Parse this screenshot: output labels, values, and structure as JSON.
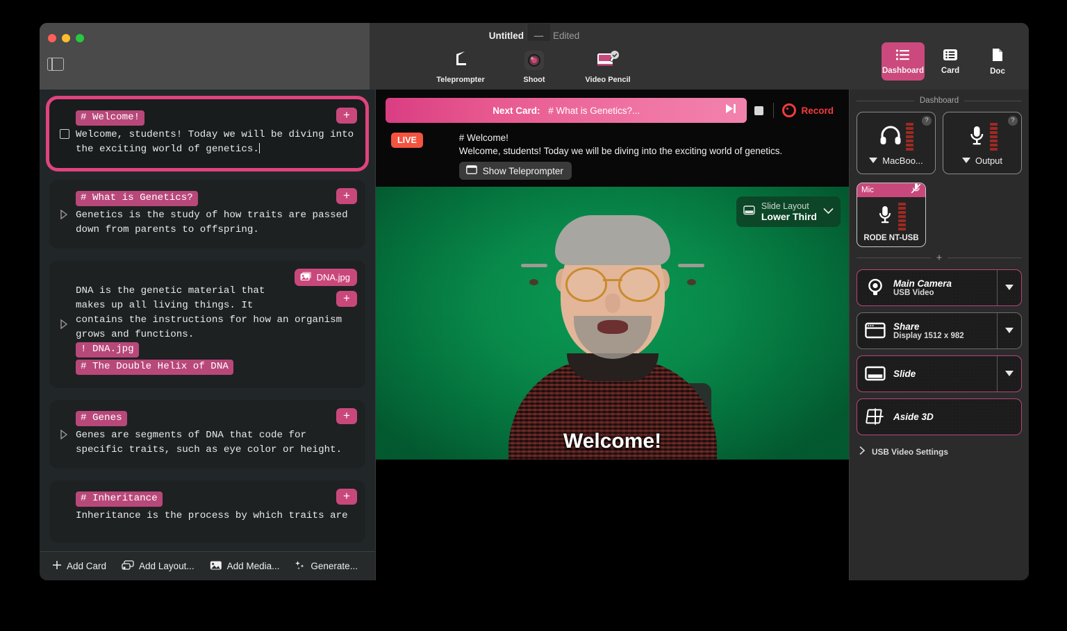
{
  "window": {
    "title": "Untitled",
    "dash": "—",
    "edited": "Edited"
  },
  "toolbar": {
    "items": [
      {
        "label": "Teleprompter",
        "icon": "teleprompter-icon"
      },
      {
        "label": "Shoot",
        "icon": "shoot-icon"
      },
      {
        "label": "Video Pencil",
        "icon": "video-pencil-icon"
      }
    ]
  },
  "view_switch": {
    "items": [
      {
        "label": "Dashboard",
        "icon": "list-icon",
        "active": true
      },
      {
        "label": "Card",
        "icon": "card-icon",
        "active": false
      },
      {
        "label": "Doc",
        "icon": "doc-icon",
        "active": false
      }
    ]
  },
  "cards": [
    {
      "selected": true,
      "marker": "square",
      "heading": "# Welcome!",
      "text": "Welcome, students! Today we will be diving into\nthe exciting world of genetics.",
      "add_label": "+"
    },
    {
      "selected": false,
      "marker": "triangle",
      "heading": "# What is Genetics?",
      "text": "Genetics is the study of how traits are passed\ndown from parents to offspring.",
      "add_label": "+"
    },
    {
      "selected": false,
      "marker": "triangle",
      "media_chip": "DNA.jpg",
      "text": "DNA is the genetic material that\nmakes up all living things. It\ncontains the instructions for how an organism\ngrows and functions.",
      "tag_media": "! DNA.jpg",
      "tag_heading": "# The Double Helix of DNA",
      "add_label": "+"
    },
    {
      "selected": false,
      "marker": "triangle",
      "heading": "# Genes",
      "text": "Genes are segments of DNA that code for\nspecific traits, such as eye color or height.",
      "add_label": "+"
    },
    {
      "selected": false,
      "marker": "none",
      "heading": "# Inheritance",
      "text": "Inheritance is the process by which traits are",
      "add_label": "+"
    }
  ],
  "cards_toolbar": {
    "items": [
      {
        "label": "Add Card",
        "icon": "plus-icon"
      },
      {
        "label": "Add Layout...",
        "icon": "layout-icon"
      },
      {
        "label": "Add Media...",
        "icon": "media-icon"
      },
      {
        "label": "Generate...",
        "icon": "sparkle-icon"
      }
    ]
  },
  "stage": {
    "next_card_label": "Next Card:",
    "next_card_value": "# What is Genetics?...",
    "skip_icon": "skip-forward-icon",
    "stop_icon": "stop-icon",
    "record_label": "Record",
    "live_badge": "LIVE",
    "live_heading": "# Welcome!",
    "live_text": "Welcome, students! Today we will be diving into the exciting world of genetics.",
    "show_teleprompter": "Show Teleprompter",
    "slide_layout_label": "Slide Layout",
    "slide_layout_value": "Lower Third",
    "lower_third_text": "Welcome!"
  },
  "dashboard": {
    "section_title": "Dashboard",
    "devices": [
      {
        "name": "MacBoo...",
        "icon": "headphones-icon",
        "help": "?"
      },
      {
        "name": "Output",
        "icon": "microphone-icon",
        "help": "?"
      }
    ],
    "mic": {
      "title": "Mic",
      "mute_icon": "mic-muted-icon",
      "device": "RODE NT-USB"
    },
    "sources": [
      {
        "title": "Main Camera",
        "subtitle": "USB Video",
        "icon": "camera-icon",
        "active": true,
        "has_caret": true
      },
      {
        "title": "Share",
        "subtitle": "Display 1512 x 982",
        "icon": "window-share-icon",
        "active": false,
        "has_caret": true
      },
      {
        "title": "Slide",
        "subtitle": "",
        "icon": "slide-icon",
        "active": true,
        "has_caret": true
      },
      {
        "title": "Aside 3D",
        "subtitle": "",
        "icon": "aside3d-icon",
        "active": true,
        "has_caret": false
      }
    ],
    "settings_row": "USB Video Settings"
  },
  "colors": {
    "accent_pink": "#c9487c",
    "accent_pink_bright": "#e0437e",
    "record_red": "#f43b3b",
    "live_orange": "#f4533f",
    "green_screen": "#08894a"
  }
}
